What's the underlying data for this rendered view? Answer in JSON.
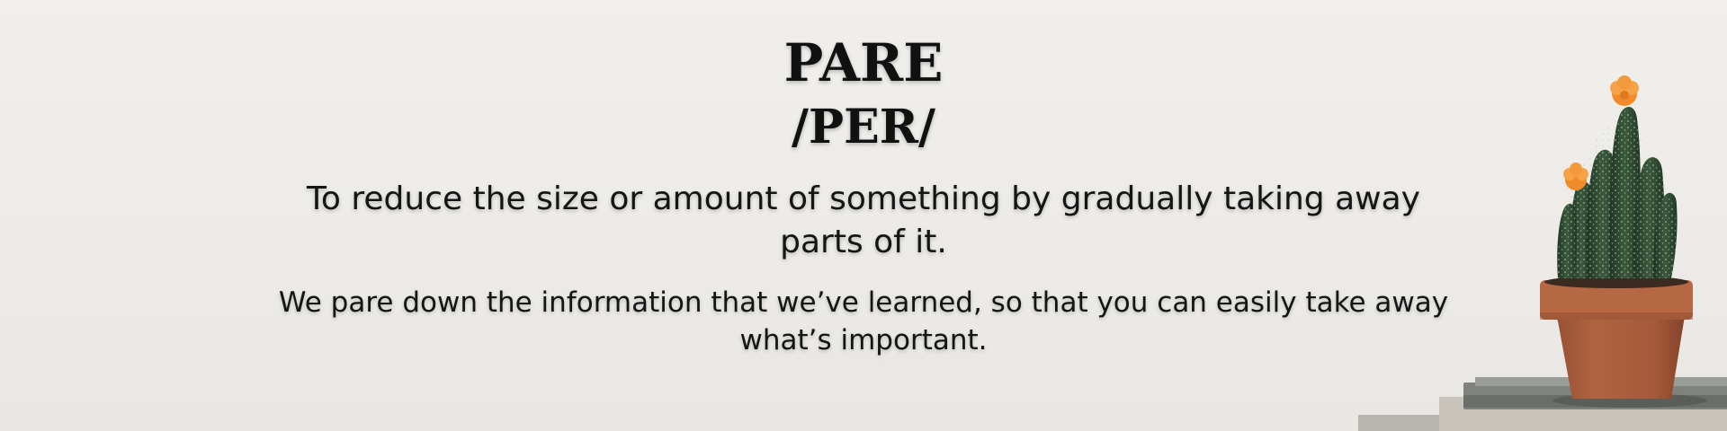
{
  "hero": {
    "word": "PARE",
    "pronunciation": "/PER/",
    "definition": "To reduce the size or amount of something by gradually taking away parts of it.",
    "example": "We pare down the information that we’ve learned, so that you can easily take away what’s important."
  },
  "decor": {
    "icon": "cactus-plant-icon",
    "pot_color": "#a65a3a",
    "cactus_color": "#2f4a32",
    "flower_color": "#f08a2a",
    "book_color": "#8b8d88"
  }
}
